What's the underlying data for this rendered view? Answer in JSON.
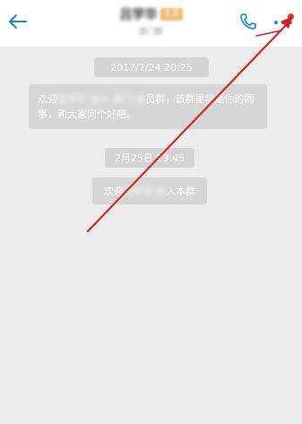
{
  "header": {
    "title": "吕学华",
    "badge": "主员",
    "subtitle": "部门群",
    "icons": {
      "back": "back-arrow-icon",
      "phone": "phone-icon",
      "more": "more-options-icon"
    },
    "accent_color": "#1a8bd8",
    "notification_color": "#e23a2a"
  },
  "messages": [
    {
      "type": "timestamp",
      "text": "2017/7/24 20:25"
    },
    {
      "type": "system",
      "line1_prefix": "欢迎",
      "line1_blurred": "吕学华 加入 部门 成",
      "line1_suffix": "员群，该群里都是你的同",
      "line2": "事，和大家问个好吧。"
    },
    {
      "type": "timestamp",
      "text": "2月25日 19:45"
    },
    {
      "type": "system",
      "prefix": "欢迎",
      "blurred": "吕学华 加",
      "suffix": "入本群"
    }
  ],
  "annotation": {
    "color": "#d42020"
  }
}
